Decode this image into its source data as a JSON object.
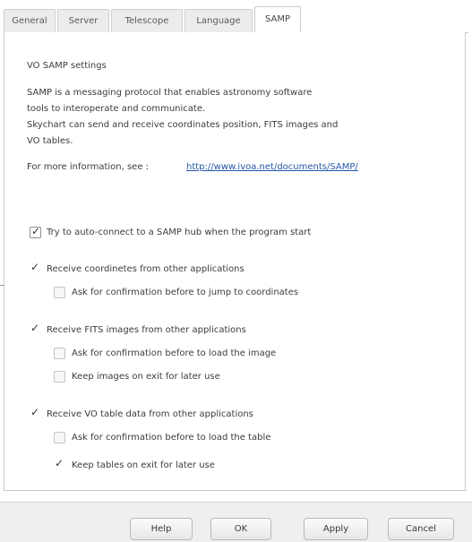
{
  "tabs": [
    "General",
    "Server",
    "Telescope",
    "Language",
    "SAMP"
  ],
  "active_tab": "SAMP",
  "heading": "VO SAMP settings",
  "description": [
    "SAMP is a messaging protocol that enables astronomy software",
    "tools to interoperate and communicate.",
    "Skychart can send and receive coordinates position, FITS images and",
    "VO tables."
  ],
  "more_info": {
    "label": "For more information, see :",
    "url": "http://www.ivoa.net/documents/SAMP/"
  },
  "options": {
    "auto_connect": {
      "label": "Try to auto-connect to a SAMP hub when the program start",
      "checked": true
    },
    "receive_coords": {
      "label": "Receive coordinetes from other applications",
      "checked": true
    },
    "confirm_jump": {
      "label": "Ask for confirmation before to jump to coordinates",
      "checked": false
    },
    "receive_fits": {
      "label": "Receive FITS images from other applications",
      "checked": true
    },
    "confirm_image": {
      "label": "Ask for confirmation before to load the image",
      "checked": false
    },
    "keep_images": {
      "label": "Keep images on exit for later use",
      "checked": false
    },
    "receive_vo": {
      "label": "Receive VO table data from other applications",
      "checked": true
    },
    "confirm_table": {
      "label": "Ask for confirmation before to load the table",
      "checked": false
    },
    "keep_tables": {
      "label": "Keep tables on exit for later use",
      "checked": true
    }
  },
  "buttons": {
    "help": "Help",
    "ok": "OK",
    "apply": "Apply",
    "cancel": "Cancel"
  },
  "colors": {
    "link": "#2458a6",
    "panel_border": "#c9c9c9",
    "footer_bg": "#efefef"
  }
}
